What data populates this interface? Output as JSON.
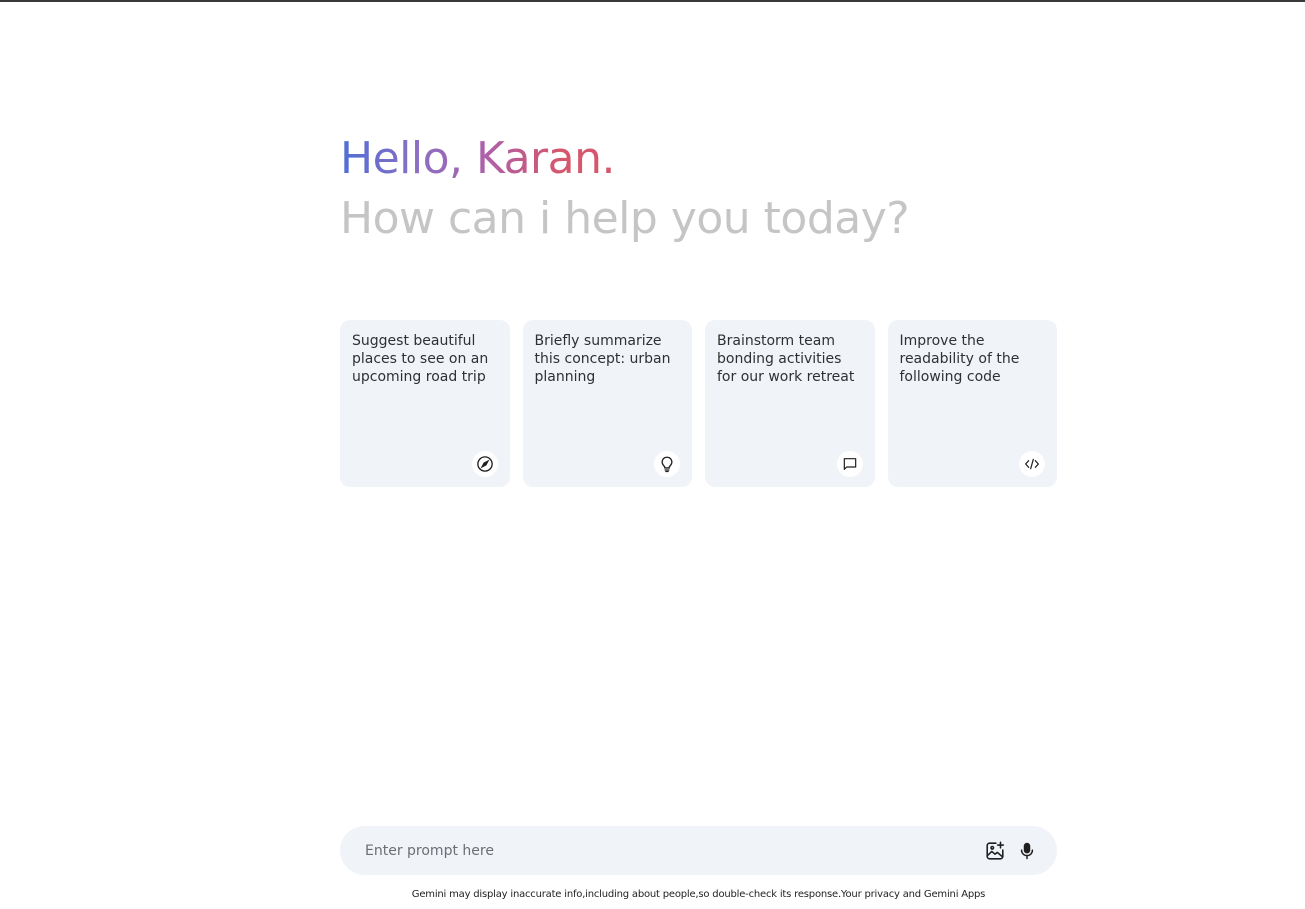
{
  "header": {
    "greeting": "Hello, Karan.",
    "subtitle": "How can i help you today?"
  },
  "suggestions": [
    {
      "text": "Suggest beautiful places to see on an upcoming road trip",
      "icon": "compass-icon"
    },
    {
      "text": "Briefly summarize this concept: urban planning",
      "icon": "lightbulb-icon"
    },
    {
      "text": "Brainstorm team bonding activities for our work retreat",
      "icon": "chat-bubble-icon"
    },
    {
      "text": "Improve the readability of the following code",
      "icon": "code-icon"
    }
  ],
  "prompt": {
    "placeholder": "Enter prompt here",
    "value": ""
  },
  "toolbar_icons": [
    "add-image-icon",
    "microphone-icon"
  ],
  "footer": {
    "disclaimer": "Gemini may display inaccurate info,including about people,so double-check its response.Your privacy and Gemini Apps"
  },
  "colors": {
    "card_background": "#f0f3f8",
    "subtitle": "#c5c5c5",
    "gradient_start": "#4f6ed6",
    "gradient_end": "#d4576c"
  }
}
